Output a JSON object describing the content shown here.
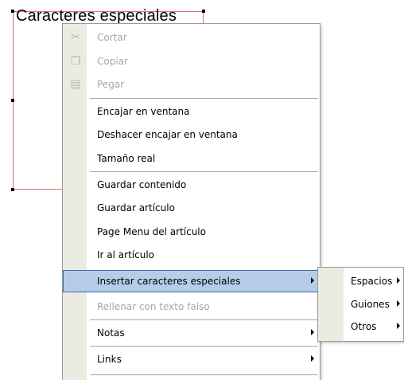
{
  "frame": {
    "text": "Caracteres especiales"
  },
  "menu": {
    "items": [
      {
        "label": "Cortar",
        "disabled": true,
        "icon": "scissors-icon",
        "submenu": false
      },
      {
        "label": "Copiar",
        "disabled": true,
        "icon": "copy-icon",
        "submenu": false
      },
      {
        "label": "Pegar",
        "disabled": true,
        "icon": "paste-icon",
        "submenu": false
      },
      {
        "label": "Encajar en ventana",
        "disabled": false,
        "submenu": false
      },
      {
        "label": "Deshacer encajar en ventana",
        "disabled": false,
        "submenu": false
      },
      {
        "label": "Tamaño real",
        "disabled": false,
        "submenu": false
      },
      {
        "label": "Guardar contenido",
        "disabled": false,
        "submenu": false
      },
      {
        "label": "Guardar artículo",
        "disabled": false,
        "submenu": false
      },
      {
        "label": "Page Menu del artículo",
        "disabled": false,
        "submenu": false
      },
      {
        "label": "Ir al artículo",
        "disabled": false,
        "submenu": false
      },
      {
        "label": "Insertar caracteres especiales",
        "disabled": false,
        "submenu": true,
        "highlighted": true
      },
      {
        "label": "Rellenar con texto falso",
        "disabled": true,
        "submenu": false
      },
      {
        "label": "Notas",
        "disabled": false,
        "submenu": true
      },
      {
        "label": "Links",
        "disabled": false,
        "submenu": true
      }
    ]
  },
  "submenu": {
    "items": [
      {
        "label": "Espacios"
      },
      {
        "label": "Guiones"
      },
      {
        "label": "Otros"
      }
    ]
  },
  "colors": {
    "highlight_fill": "#b6cde9",
    "highlight_border": "#3a6ea5",
    "gutter": "#ecebe1",
    "frame_border": "#e06a6a",
    "disabled_text": "#a7a6aa"
  }
}
